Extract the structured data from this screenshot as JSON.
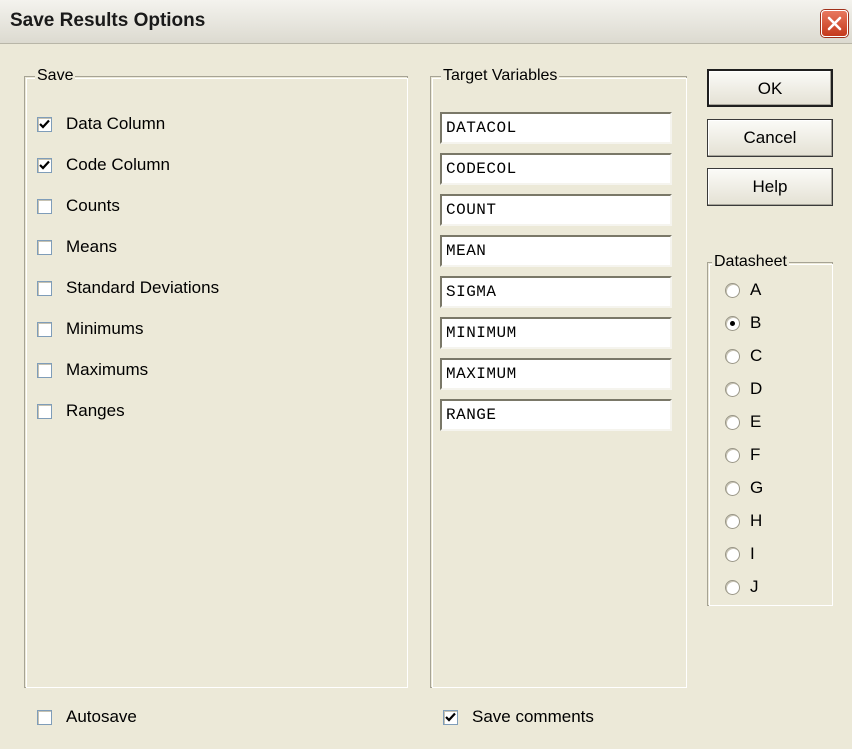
{
  "dialog": {
    "title": "Save Results Options"
  },
  "save_group": {
    "label": "Save",
    "items": [
      {
        "label": "Data Column",
        "checked": true
      },
      {
        "label": "Code Column",
        "checked": true
      },
      {
        "label": "Counts",
        "checked": false
      },
      {
        "label": "Means",
        "checked": false
      },
      {
        "label": "Standard Deviations",
        "checked": false
      },
      {
        "label": "Minimums",
        "checked": false
      },
      {
        "label": "Maximums",
        "checked": false
      },
      {
        "label": "Ranges",
        "checked": false
      }
    ]
  },
  "target_group": {
    "label": "Target Variables",
    "values": [
      "DATACOL",
      "CODECOL",
      "COUNT",
      "MEAN",
      "SIGMA",
      "MINIMUM",
      "MAXIMUM",
      "RANGE"
    ]
  },
  "buttons": {
    "ok": "OK",
    "cancel": "Cancel",
    "help": "Help"
  },
  "datasheet_group": {
    "label": "Datasheet",
    "options": [
      "A",
      "B",
      "C",
      "D",
      "E",
      "F",
      "G",
      "H",
      "I",
      "J"
    ],
    "selected": "B"
  },
  "footer": {
    "autosave": {
      "label": "Autosave",
      "checked": false
    },
    "save_comments": {
      "label": "Save comments",
      "checked": true
    }
  },
  "colors": {
    "title_bg": "#ece9d8",
    "close_button": "#d4502e"
  },
  "icons": {
    "close": "close-icon",
    "check": "checkmark-icon"
  }
}
